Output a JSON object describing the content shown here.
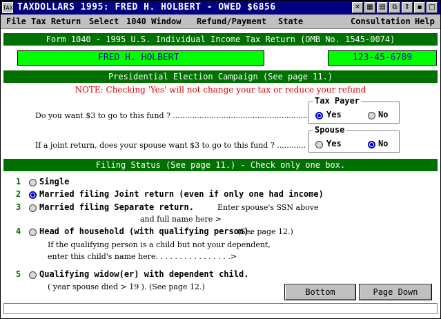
{
  "window": {
    "title": "TAXDOLLARS 1995:  FRED H. HOLBERT - OWED $6856",
    "sys_icon": "sys-menu-icon"
  },
  "menu": {
    "file": "File",
    "tax_return": "Tax Return",
    "select": "Select",
    "window_1040": "1040 Window",
    "refund": "Refund/Payment",
    "state": "State",
    "consultation": "Consultation",
    "help": "Help"
  },
  "form": {
    "header": "Form 1040 - 1995 U.S. Individual Income Tax Return  (OMB No. 1545-0074)",
    "name": "FRED H.  HOLBERT",
    "ssn": "123-45-6789"
  },
  "election": {
    "header": "Presidential Election Campaign (See page 11.)",
    "note": "NOTE: Checking 'Yes' will not change your tax or reduce your refund",
    "q1": "Do you want $3 to go to this fund ? ........................................................",
    "q2": "If a joint return, does your spouse want $3 to go to this fund ? ............",
    "taxpayer_label": "Tax Payer",
    "spouse_label": "Spouse",
    "yes": "Yes",
    "no": "No",
    "taxpayer_value": "Yes",
    "spouse_value": "No"
  },
  "filing": {
    "header": "Filing Status (See page 11.) - Check only one box.",
    "selected": 2,
    "opt1": "Single",
    "opt2": "Married filing Joint return (even if only one had income)",
    "opt3": "Married filing Separate return.",
    "opt3_note": "Enter spouse's SSN above",
    "opt3_note2": "and full name here >",
    "opt4": "Head of household (with qualifying person).",
    "opt4_note": "(See page 12.)",
    "opt4_sub1": "If the qualifying person is a child but not your dependent,",
    "opt4_sub2": "enter this child's name here. . . . . . . . . . . . . . . .>",
    "opt5": "Qualifying widow(er) with dependent child.",
    "opt5_sub": "( year spouse died > 19          ). (See page 12.)"
  },
  "buttons": {
    "bottom": "Bottom",
    "page_down": "Page Down"
  }
}
